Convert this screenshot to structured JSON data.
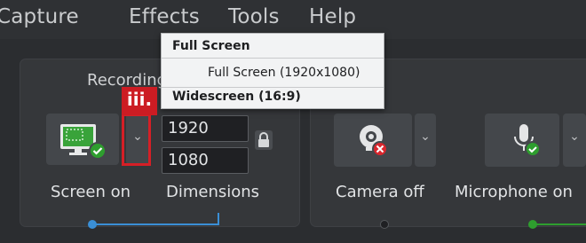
{
  "menu": {
    "items": [
      "Capture",
      "Effects",
      "Tools",
      "Help"
    ]
  },
  "recording_section": {
    "title": "Recording",
    "dimensions": {
      "width": "1920",
      "height": "1080"
    },
    "labels": {
      "screen": "Screen on",
      "dimensions": "Dimensions"
    }
  },
  "camera": {
    "label": "Camera off"
  },
  "microphone": {
    "label": "Microphone on"
  },
  "dropdown": {
    "group1_header": "Full Screen",
    "group1_item": "Full Screen (1920x1080)",
    "group2_header": "Widescreen (16:9)"
  },
  "callout": {
    "text": "iii."
  },
  "icons": {
    "screen": "monitor-check-icon",
    "camera": "webcam-off-icon",
    "microphone": "microphone-check-icon",
    "lock": "lock-icon",
    "chevron": "chevron-down-icon"
  },
  "colors": {
    "accent_green": "#2e9e2e",
    "accent_blue": "#3a8fd6",
    "error_red": "#d9262d",
    "callout_red": "#cc1c23"
  }
}
